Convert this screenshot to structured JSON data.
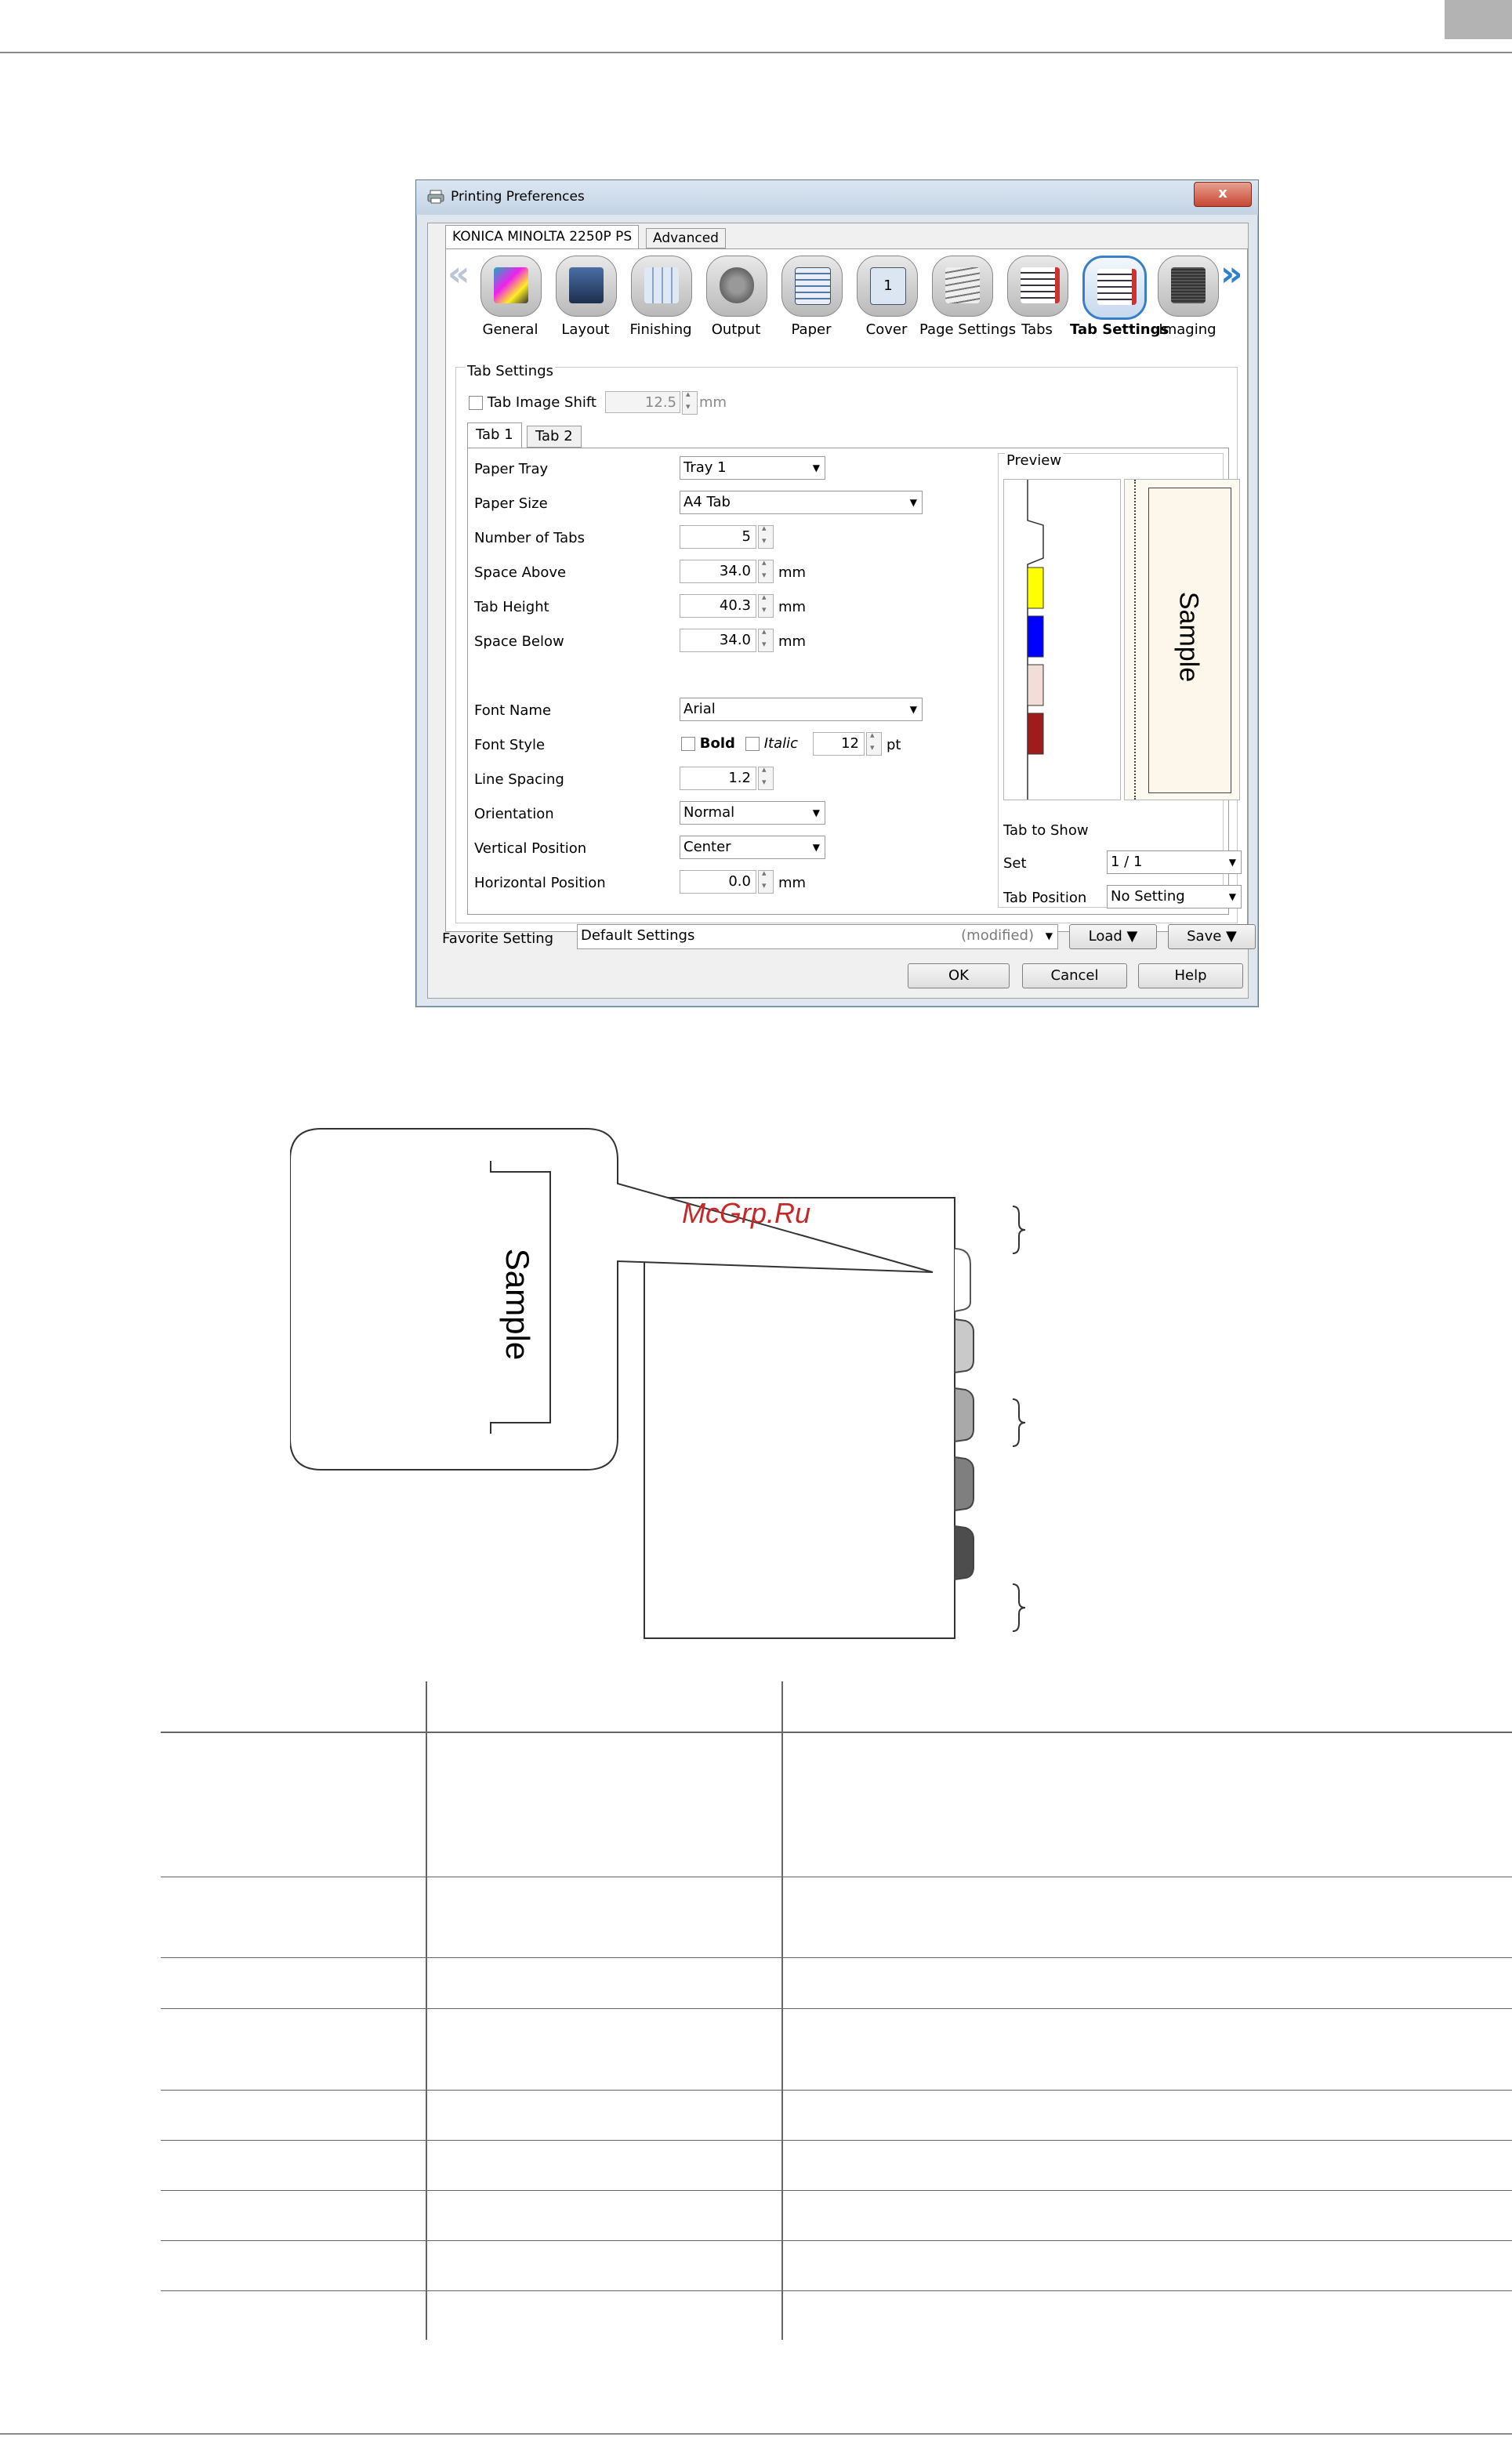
{
  "dialog": {
    "title": "Printing Preferences",
    "close_label": "x",
    "tabs": [
      "KONICA MINOLTA 2250P PS",
      "Advanced"
    ],
    "toolbar": [
      {
        "label": "General",
        "icon": "general-icon"
      },
      {
        "label": "Layout",
        "icon": "layout-icon"
      },
      {
        "label": "Finishing",
        "icon": "finishing-icon"
      },
      {
        "label": "Output",
        "icon": "output-icon"
      },
      {
        "label": "Paper",
        "icon": "paper-icon"
      },
      {
        "label": "Cover",
        "icon": "cover-icon"
      },
      {
        "label": "Page Settings",
        "icon": "page-settings-icon"
      },
      {
        "label": "Tabs",
        "icon": "tabs-icon"
      },
      {
        "label": "Tab Settings",
        "icon": "tab-settings-icon",
        "active": true
      },
      {
        "label": "Imaging",
        "icon": "imaging-icon"
      }
    ],
    "cover_glyph": "1",
    "chevron_left": "«",
    "chevron_right": "»",
    "group_title": "Tab Settings",
    "image_shift": {
      "label": "Tab Image Shift",
      "value": "12.5",
      "unit": "mm"
    },
    "subtabs": [
      "Tab 1",
      "Tab 2"
    ],
    "fields": {
      "paper_tray": {
        "label": "Paper Tray",
        "value": "Tray 1"
      },
      "paper_size": {
        "label": "Paper Size",
        "value": "A4 Tab"
      },
      "number_of_tabs": {
        "label": "Number of Tabs",
        "value": "5"
      },
      "space_above": {
        "label": "Space Above",
        "value": "34.0",
        "unit": "mm"
      },
      "tab_height": {
        "label": "Tab Height",
        "value": "40.3",
        "unit": "mm"
      },
      "space_below": {
        "label": "Space Below",
        "value": "34.0",
        "unit": "mm"
      },
      "font_name": {
        "label": "Font Name",
        "value": "Arial"
      },
      "font_style": {
        "label": "Font Style",
        "bold": "Bold",
        "italic": "Italic",
        "size": "12",
        "unit": "pt"
      },
      "line_spacing": {
        "label": "Line Spacing",
        "value": "1.2"
      },
      "orientation": {
        "label": "Orientation",
        "value": "Normal"
      },
      "vertical_position": {
        "label": "Vertical Position",
        "value": "Center"
      },
      "horizontal_position": {
        "label": "Horizontal Position",
        "value": "0.0",
        "unit": "mm"
      }
    },
    "preview": {
      "title": "Preview",
      "sample_text": "Sample",
      "tab_colors": [
        "#ffff00",
        "#0000ff",
        "#f2ddd8",
        "#a01c1c"
      ],
      "tab_to_show": "Tab to Show",
      "set": {
        "label": "Set",
        "value": "1 / 1"
      },
      "tab_position": {
        "label": "Tab Position",
        "value": "No Setting"
      }
    },
    "favorite": {
      "label": "Favorite Setting",
      "value": "Default Settings",
      "modified": "(modified)"
    },
    "buttons": {
      "load": "Load",
      "save": "Save",
      "ok": "OK",
      "cancel": "Cancel",
      "help": "Help"
    }
  },
  "diagram": {
    "sample_text": "Sample",
    "watermark": "McGrp.Ru",
    "tab_fills": [
      "#c9c9c9",
      "#a9a9a9",
      "#7f7f7f",
      "#4d4d4d"
    ]
  }
}
